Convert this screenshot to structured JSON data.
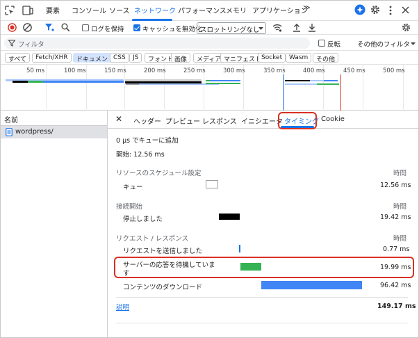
{
  "top_tabs": {
    "elements": "要素",
    "console": "コンソール",
    "sources": "ソース",
    "network": "ネットワーク",
    "performance": "パフォーマンス",
    "memory": "メモリ",
    "application": "アプリケーション",
    "more": "≫"
  },
  "toolbar": {
    "preserve_log": "ログを保持",
    "disable_cache": "キャッシュを無効化",
    "throttling": "スロットリングなし"
  },
  "filter": {
    "placeholder": "フィルタ",
    "invert": "反転",
    "more_filters": "その他のフィルタ"
  },
  "chips": [
    "すべて",
    "Fetch/XHR",
    "ドキュメント",
    "CSS",
    "JS",
    "フォント",
    "画像",
    "メディア",
    "マニフェスト",
    "Socket",
    "Wasm",
    "その他"
  ],
  "overview": {
    "ticks": [
      "50 ms",
      "100 ms",
      "150 ms",
      "200 ms",
      "250 ms",
      "300 ms",
      "350 ms",
      "400 ms",
      "450 ms",
      "500 ms"
    ]
  },
  "left_panel": {
    "header": "名前",
    "rows": [
      "wordpress/"
    ]
  },
  "detail_tabs": {
    "close": "✕",
    "headers": "ヘッダー",
    "preview": "プレビュー",
    "response": "レスポンス",
    "initiator": "イニシエータ",
    "timing": "タイミング",
    "cookie": "Cookie"
  },
  "timing": {
    "queued_at": "0 µs でキューに追加",
    "started_at": "開始: 12.56 ms",
    "sections": [
      {
        "title": "リソースのスケジュール設定",
        "col": "時間",
        "rows": [
          {
            "label": "キュー",
            "value": "12.56 ms"
          }
        ]
      },
      {
        "title": "接続開始",
        "col": "時間",
        "rows": [
          {
            "label": "停止しました",
            "value": "19.42 ms"
          }
        ]
      },
      {
        "title": "リクエスト / レスポンス",
        "col": "時間",
        "rows": [
          {
            "label": "リクエストを送信しました",
            "value": "0.77 ms"
          },
          {
            "label": "サーバーの応答を待機していま",
            "label2": "す",
            "value": "19.99 ms"
          },
          {
            "label": "コンテンツのダウンロード",
            "value": "96.42 ms"
          }
        ]
      }
    ],
    "explanation": "説明",
    "total": "149.17 ms"
  },
  "colors": {
    "accent": "#1a73e8",
    "highlight": "#d93025",
    "stalled": "#000000",
    "waiting": "#34b354",
    "download": "#4285f4"
  }
}
